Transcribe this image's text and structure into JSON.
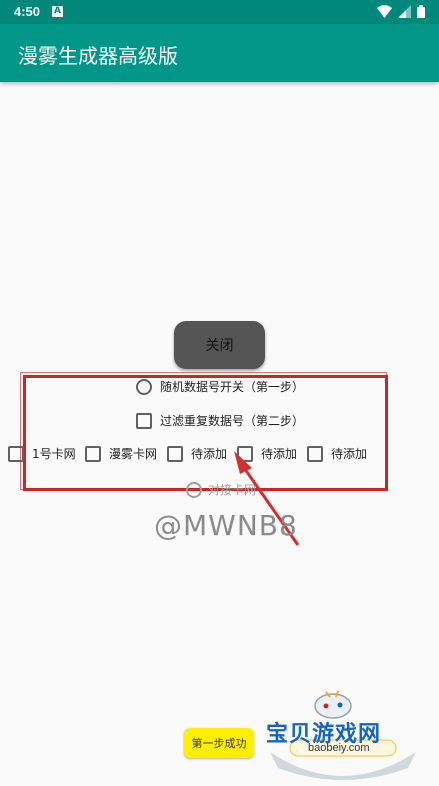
{
  "status_bar": {
    "time": "4:50",
    "notification_icon": "A"
  },
  "appbar": {
    "title": "漫雾生成器高级版"
  },
  "close_button": {
    "label": "关闭"
  },
  "options": {
    "random_switch": "随机数据号开关（第一步）",
    "filter_duplicates": "过滤重复数据号（第二步）"
  },
  "checkboxes": [
    {
      "label": "1号卡网"
    },
    {
      "label": "漫雾卡网"
    },
    {
      "label": "待添加"
    },
    {
      "label": "待添加"
    },
    {
      "label": "待添加"
    }
  ],
  "connect_option": {
    "label": "对接卡网"
  },
  "watermark": {
    "text": "@MWNB8"
  },
  "step_one_button": {
    "label": "第一步成功"
  },
  "logo": {
    "title": "宝贝游戏网",
    "domain": "baobeiy.com"
  },
  "colors": {
    "appbar": "#009688",
    "status_bar": "#00897b",
    "highlight": "#c62828",
    "button_yellow": "#ffee00"
  }
}
